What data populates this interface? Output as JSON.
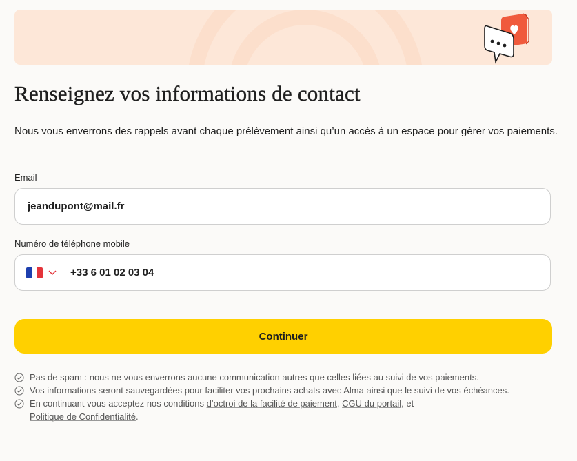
{
  "banner": {
    "illustration": "chat-bubble-heart-icon"
  },
  "page": {
    "title": "Renseignez vos informations de contact",
    "intro": "Nous vous enverrons des rappels avant chaque prélèvement ainsi qu’un accès à un espace pour gérer vos paiements."
  },
  "email": {
    "label": "Email",
    "value": "jeandupont@mail.fr"
  },
  "phone": {
    "label": "Numéro de téléphone mobile",
    "country_flag": "france-flag-icon",
    "value": "+33 6 01 02 03 04"
  },
  "actions": {
    "continue_label": "Continuer"
  },
  "notes": {
    "spam": "Pas de spam : nous ne vous enverrons aucune communication autres que celles liées au suivi de vos paiements.",
    "saved": "Vos informations seront sauvegardées pour faciliter vos prochains achats avec Alma ainsi que le suivi de vos échéances.",
    "terms_prefix": "En continuant vous acceptez nos conditions ",
    "terms_link1": "d’octroi de la facilité de paiement",
    "terms_sep": ", ",
    "terms_link2": "CGU du portail",
    "terms_and": ", et",
    "terms_link3": "Politique de Confidentialité",
    "terms_end": "."
  },
  "colors": {
    "accent": "#ffd000",
    "banner_bg": "#fde7d8",
    "flag_blue": "#1d3fae",
    "flag_red": "#e4343a",
    "heart_bubble": "#f05a3c"
  }
}
